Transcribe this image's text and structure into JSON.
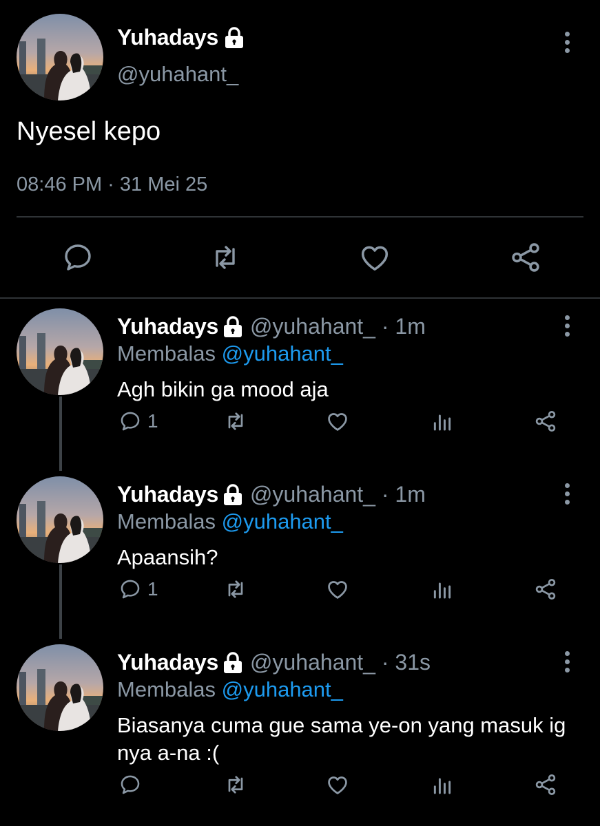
{
  "main_tweet": {
    "display_name": "Yuhadays",
    "handle": "@yuhahant_",
    "text": "Nyesel kepo",
    "timestamp": "08:46 PM · 31 Mei 25",
    "lock_icon": "lock-icon",
    "menu_icon": "more-vertical-icon",
    "actions": [
      {
        "name": "reply",
        "icon": "reply-icon"
      },
      {
        "name": "retweet",
        "icon": "retweet-icon"
      },
      {
        "name": "like",
        "icon": "heart-icon"
      },
      {
        "name": "share",
        "icon": "share-icon"
      }
    ]
  },
  "replies": [
    {
      "display_name": "Yuhadays",
      "meta": "@yuhahant_ · 1m",
      "replying_prefix": "Membalas",
      "replying_to": "@yuhahant_",
      "text": "Agh bikin ga mood aja",
      "reply_count": "1"
    },
    {
      "display_name": "Yuhadays",
      "meta": "@yuhahant_ · 1m",
      "replying_prefix": "Membalas",
      "replying_to": "@yuhahant_",
      "text": "Apaansih?",
      "reply_count": "1"
    },
    {
      "display_name": "Yuhadays",
      "meta": "@yuhahant_ · 31s",
      "replying_prefix": "Membalas",
      "replying_to": "@yuhahant_",
      "text": "Biasanya cuma gue sama ye-on yang masuk ig nya a-na :(",
      "reply_count": ""
    }
  ],
  "colors": {
    "background": "#000000",
    "secondary_text": "#8b98a5",
    "mention": "#1d9bf0",
    "divider": "#2f3336"
  }
}
